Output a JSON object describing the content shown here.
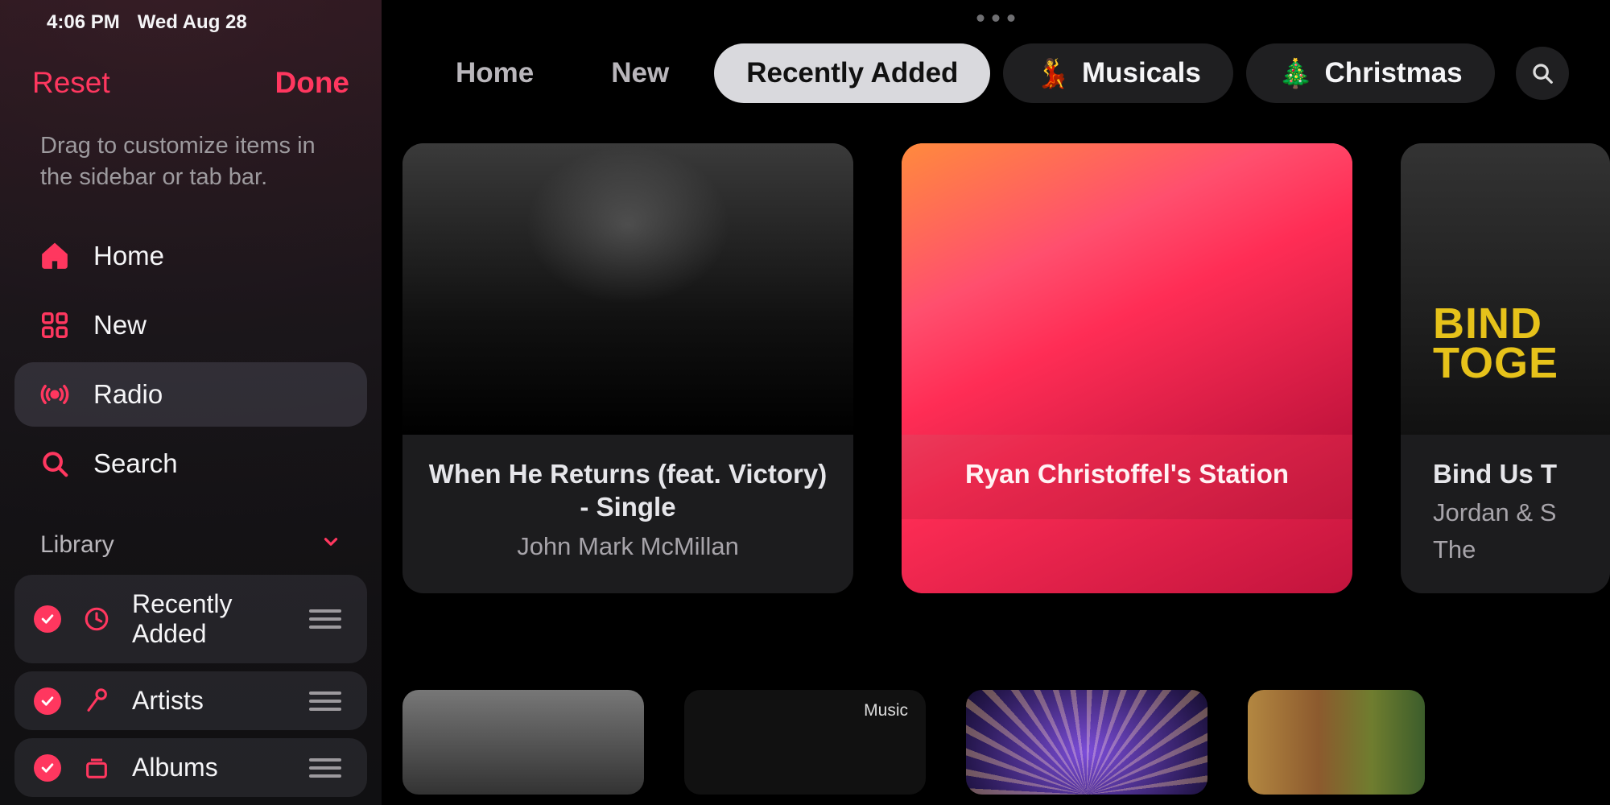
{
  "status": {
    "time": "4:06 PM",
    "date": "Wed Aug 28"
  },
  "sidebar": {
    "reset": "Reset",
    "done": "Done",
    "hint": "Drag to customize items in the sidebar or tab bar.",
    "nav": [
      {
        "label": "Home",
        "icon": "home"
      },
      {
        "label": "New",
        "icon": "grid"
      },
      {
        "label": "Radio",
        "icon": "radio",
        "active": true
      },
      {
        "label": "Search",
        "icon": "search"
      }
    ],
    "library_header": "Library",
    "library": [
      {
        "label": "Recently Added",
        "icon": "clock",
        "checked": true
      },
      {
        "label": "Artists",
        "icon": "microphone",
        "checked": true
      },
      {
        "label": "Albums",
        "icon": "albums",
        "checked": true
      }
    ]
  },
  "tabs": {
    "items": [
      {
        "label": "Home",
        "style": "plain"
      },
      {
        "label": "New",
        "style": "plain"
      },
      {
        "label": "Recently Added",
        "style": "active"
      },
      {
        "label": "Musicals",
        "style": "emoji",
        "emoji": "💃"
      },
      {
        "label": "Christmas",
        "style": "emoji",
        "emoji": "🎄"
      }
    ]
  },
  "row1": {
    "card1": {
      "title": "When He Returns (feat. Victory) - Single",
      "subtitle": "John Mark McMillan"
    },
    "card2": {
      "title": "Ryan Christoffel's Station"
    },
    "card3": {
      "art_text": "BIND\nTOGE",
      "title": "Bind Us T",
      "subtitle1": "Jordan & S",
      "subtitle2": "The"
    }
  },
  "row2": {
    "music_badge": "Music"
  },
  "accent": "#ff375f"
}
